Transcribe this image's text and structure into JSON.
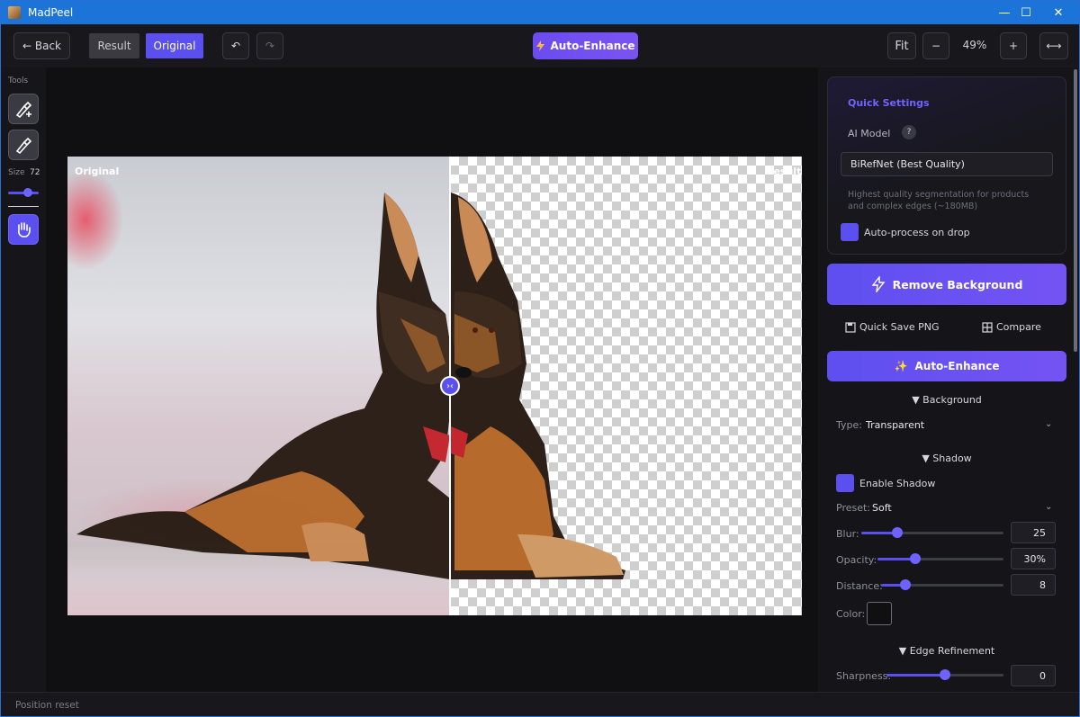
{
  "window": {
    "title": "MadPeel",
    "minimize": "—",
    "maximize": "☐",
    "close": "✕"
  },
  "toolbar": {
    "back_label": "← Back",
    "result_label": "Result",
    "original_label": "Original",
    "undo_label": "↶",
    "redo_label": "↷",
    "auto_enhance_label": "Auto-Enhance",
    "fit_label": "Fit",
    "zoom_out_label": "−",
    "zoom_level": "49%",
    "zoom_in_label": "+",
    "fit_width_label": "⟷"
  },
  "tools": {
    "label": "Tools",
    "size_label": "Size",
    "size_value": "72",
    "brush_size_fraction": 0.65
  },
  "canvas": {
    "left_label": "Original",
    "right_label": "Result",
    "split_fraction": 0.52,
    "divider_glyph": "›‹"
  },
  "quick_settings": {
    "heading": "Quick Settings",
    "ai_model_label": "AI Model",
    "help_glyph": "?",
    "ai_model_value": "BiRefNet (Best Quality)",
    "description": "Highest quality segmentation for products and complex edges (~180MB)",
    "auto_process_label": "Auto-process on drop"
  },
  "actions": {
    "remove_bg_label": "Remove Background",
    "quick_save_label": "Quick Save PNG",
    "compare_label": "Compare",
    "auto_enhance_label": "Auto-Enhance"
  },
  "background": {
    "section_label": "▼ Background",
    "type_label": "Type:",
    "type_value": "Transparent"
  },
  "shadow": {
    "section_label": "▼ Shadow",
    "enable_label": "Enable Shadow",
    "preset_label": "Preset:",
    "preset_value": "Soft",
    "blur_label": "Blur:",
    "blur_value": "25",
    "blur_fraction": 0.25,
    "opacity_label": "Opacity:",
    "opacity_value": "30%",
    "opacity_fraction": 0.3,
    "distance_label": "Distance:",
    "distance_value": "8",
    "distance_fraction": 0.2,
    "color_label": "Color:",
    "color_value": "#101013"
  },
  "edge": {
    "section_label": "▼ Edge Refinement",
    "sharpness_label": "Sharpness:",
    "sharpness_value": "0",
    "sharpness_fraction": 0.5
  },
  "status": {
    "message": "Position reset"
  },
  "colors": {
    "accent": "#5b4ff0",
    "titlebar": "#1d74d8"
  }
}
